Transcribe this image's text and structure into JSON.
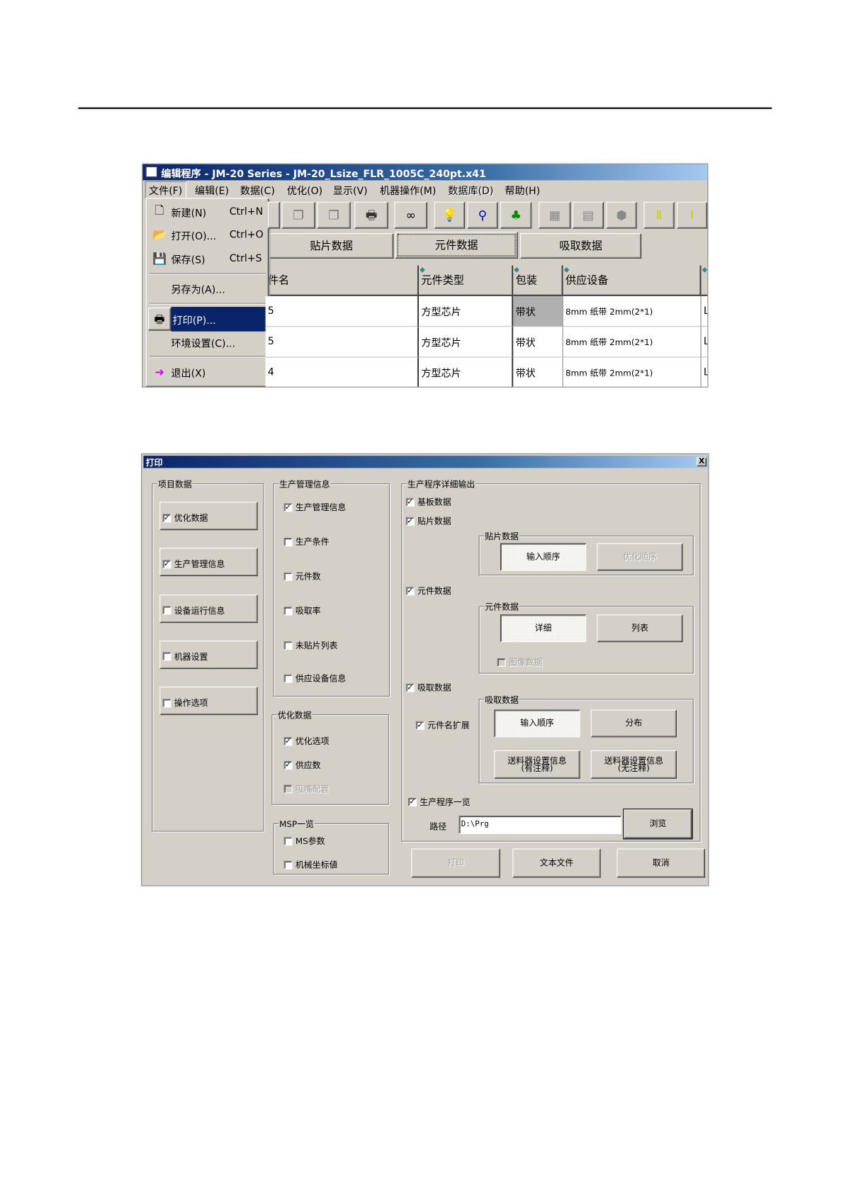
{
  "editor": {
    "title": "编辑程序 - JM-20 Series - JM-20_Lsize_FLR_1005C_240pt.x41",
    "menu": [
      "文件(F)",
      "编辑(E)",
      "数据(C)",
      "优化(O)",
      "显示(V)",
      "机器操作(M)",
      "数据库(D)",
      "帮助(H)"
    ],
    "toolbar_icons": [
      "copy-icon",
      "paste-icon",
      "print-icon",
      "binoculars-icon",
      "lightbulb-icon",
      "nozzle-icon",
      "components-icon",
      "chip-icon",
      "feeder-icon",
      "box-icon",
      "align-x-icon",
      "align-y-icon"
    ],
    "tabs": [
      "贴片数据",
      "元件数据",
      "吸取数据"
    ],
    "columns": [
      "件名",
      "元件类型",
      "包装",
      "供应设备"
    ],
    "rows": [
      {
        "name": "5",
        "type": "方型芯片",
        "pack": "带状",
        "feeder": "8mm 纸带 2mm(2*1)",
        "extra": "L"
      },
      {
        "name": "5",
        "type": "方型芯片",
        "pack": "带状",
        "feeder": "8mm 纸带 2mm(2*1)",
        "extra": "L"
      },
      {
        "name": "4",
        "type": "方型芯片",
        "pack": "带状",
        "feeder": "8mm 纸带 2mm(2*1)",
        "extra": "L"
      }
    ],
    "file_menu": [
      {
        "label": "新建(N)",
        "shortcut": "Ctrl+N",
        "icon": "new-file-icon"
      },
      {
        "label": "打开(O)...",
        "shortcut": "Ctrl+O",
        "icon": "open-folder-icon"
      },
      {
        "label": "保存(S)",
        "shortcut": "Ctrl+S",
        "icon": "save-icon"
      },
      {
        "label": "另存为(A)..."
      },
      {
        "label": "打印(P)...",
        "icon": "print-icon"
      },
      {
        "label": "环境设置(C)..."
      },
      {
        "label": "退出(X)",
        "icon": "exit-icon"
      }
    ]
  },
  "dialog": {
    "title": "打印",
    "close": "X",
    "project": {
      "label": "项目数据",
      "items": [
        {
          "label": "优化数据",
          "checked": true
        },
        {
          "label": "生产管理信息",
          "checked": true
        },
        {
          "label": "设备运行信息",
          "checked": false
        },
        {
          "label": "机器设置",
          "checked": false
        },
        {
          "label": "操作选项",
          "checked": false
        }
      ]
    },
    "prod": {
      "label": "生产管理信息",
      "items": [
        {
          "label": "生产管理信息",
          "checked": true
        },
        {
          "label": "生产条件",
          "checked": false
        },
        {
          "label": "元件数",
          "checked": false
        },
        {
          "label": "吸取率",
          "checked": false
        },
        {
          "label": "未贴片列表",
          "checked": false
        },
        {
          "label": "供应设备信息",
          "checked": false
        }
      ]
    },
    "opt": {
      "label": "优化数据",
      "items": [
        {
          "label": "优化选项",
          "checked": true
        },
        {
          "label": "供应数",
          "checked": true
        },
        {
          "label": "吸嘴配置",
          "checked": false,
          "disabled": true
        }
      ]
    },
    "msp": {
      "label": "MSP一览",
      "items": [
        {
          "label": "MS参数",
          "checked": false
        },
        {
          "label": "机械坐标値",
          "checked": false
        }
      ]
    },
    "detail": {
      "label": "生产程序详细输出",
      "board": "基板数据",
      "placement": "贴片数据",
      "placement_group": "贴片数据",
      "input_order": "输入顺序",
      "opt_order": "优化顺序",
      "component": "元件数据",
      "component_group": "元件数据",
      "detail": "详细",
      "list": "列表",
      "image": "图像数据",
      "pickup": "吸取数据",
      "pickup_group": "吸取数据",
      "name_ext": "元件名扩展",
      "pick_input_order": "输入顺序",
      "distribution": "分布",
      "feeder_with_line1": "送料器设置信息",
      "feeder_with_line2": "(有注释)",
      "feeder_without_line1": "送料器设置信息",
      "feeder_without_line2": "(无注释)",
      "program_list": "生产程序一览",
      "path_label": "路径",
      "path_value": "D:\\Prg",
      "browse": "浏览"
    },
    "buttons": {
      "print": "打印",
      "text_file": "文本文件",
      "cancel": "取消"
    }
  }
}
